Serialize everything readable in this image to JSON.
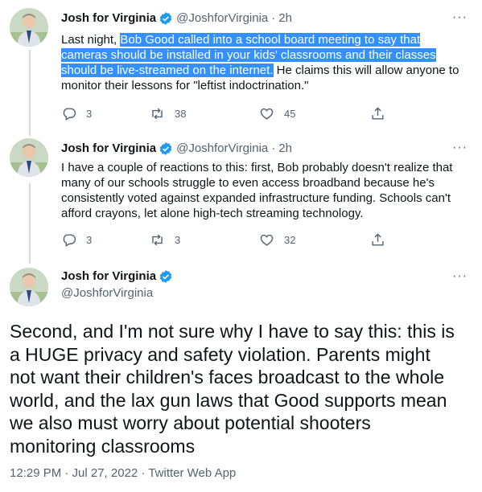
{
  "tweets": [
    {
      "name": "Josh for Virginia",
      "handle": "@JoshforVirginia",
      "separator": "·",
      "time": "2h",
      "text_before": "Last night, ",
      "text_highlight": "Bob Good called into a school board meeting to say that cameras should be installed in your kids' classrooms and their classes should be live-streamed on the internet.",
      "text_after": " He claims this will allow anyone to monitor their lessons for \"leftist indoctrination.\"",
      "replies": "3",
      "retweets": "38",
      "likes": "45"
    },
    {
      "name": "Josh for Virginia",
      "handle": "@JoshforVirginia",
      "separator": "·",
      "time": "2h",
      "text": "I have a couple of reactions to this: first, Bob probably doesn't realize that many of our schools struggle  to even access broadband because he's consistently voted against expanded infrastructure funding. Schools can't afford crayons, let alone high-tech streaming technology.",
      "replies": "3",
      "retweets": "3",
      "likes": "32"
    }
  ],
  "main_tweet": {
    "name": "Josh for Virginia",
    "handle": "@JoshforVirginia",
    "text": "Second, and I'm not sure why I have to say this: this is a HUGE privacy and safety violation. Parents might not want their children's faces broadcast to the whole world, and the lax gun laws that Good supports mean we also must worry about potential shooters monitoring classrooms",
    "timestamp": "12:29 PM · Jul 27, 2022",
    "separator": " · ",
    "source": "Twitter Web App"
  },
  "more_label": "···",
  "colors": {
    "text": "#0f1419",
    "secondary": "#536471",
    "verified": "#1d9bf0",
    "highlight": "#3390ff",
    "thread_line": "#cfd9de"
  },
  "icons": [
    "reply-icon",
    "retweet-icon",
    "like-icon",
    "share-icon",
    "verified-badge-icon",
    "more-icon"
  ]
}
